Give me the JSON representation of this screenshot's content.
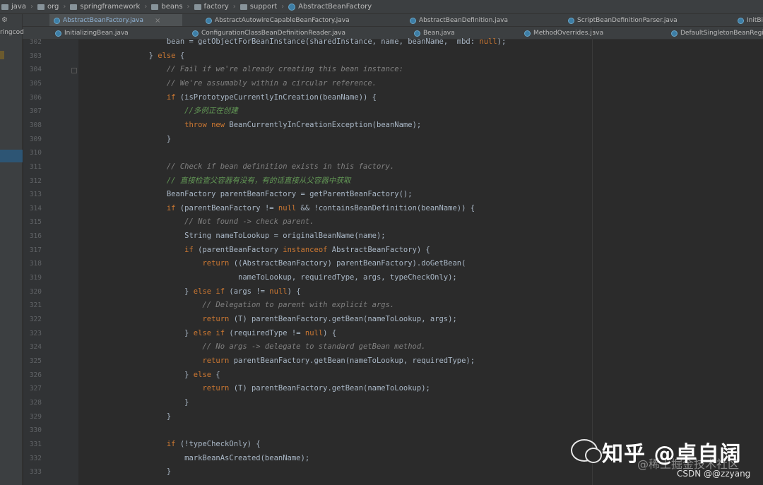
{
  "breadcrumb": [
    "java",
    "org",
    "springframework",
    "beans",
    "factory",
    "support",
    "AbstractBeanFactory"
  ],
  "tabs_row1": [
    {
      "label": "AbstractBeanFactory.java",
      "active": true
    },
    {
      "label": "AbstractAutowireCapableBeanFactory.java"
    },
    {
      "label": "AbstractBeanDefinition.java"
    },
    {
      "label": "ScriptBeanDefinitionParser.java"
    },
    {
      "label": "InitBin"
    }
  ],
  "tabs_row2": [
    {
      "label": "InitializingBean.java"
    },
    {
      "label": "ConfigurationClassBeanDefinitionReader.java"
    },
    {
      "label": "Bean.java"
    },
    {
      "label": "MethodOverrides.java"
    },
    {
      "label": "DefaultSingletonBeanRegis"
    }
  ],
  "sidebar": {
    "label": "ringcod"
  },
  "code_lines": [
    {
      "num": "302",
      "text": "            bean = getObjectForBeanInstance(sharedInstance, name, beanName,  mbd: null);",
      "type": "code"
    },
    {
      "num": "303",
      "text": "        } else {",
      "type": "code"
    },
    {
      "num": "304",
      "text": "            // Fail if we're already creating this bean instance:",
      "type": "comment"
    },
    {
      "num": "305",
      "text": "            // We're assumably within a circular reference.",
      "type": "comment"
    },
    {
      "num": "306",
      "text": "            if (isPrototypeCurrentlyInCreation(beanName)) {",
      "type": "code"
    },
    {
      "num": "307",
      "text": "                //多例正在创建",
      "type": "comment-cn"
    },
    {
      "num": "308",
      "text": "                throw new BeanCurrentlyInCreationException(beanName);",
      "type": "code"
    },
    {
      "num": "309",
      "text": "            }",
      "type": "code"
    },
    {
      "num": "310",
      "text": "",
      "type": "code"
    },
    {
      "num": "311",
      "text": "            // Check if bean definition exists in this factory.",
      "type": "comment"
    },
    {
      "num": "312",
      "text": "            // 直接检查父容器有没有，有的话直接从父容器中获取",
      "type": "comment-cn"
    },
    {
      "num": "313",
      "text": "            BeanFactory parentBeanFactory = getParentBeanFactory();",
      "type": "code"
    },
    {
      "num": "314",
      "text": "            if (parentBeanFactory != null && !containsBeanDefinition(beanName)) {",
      "type": "code"
    },
    {
      "num": "315",
      "text": "                // Not found -> check parent.",
      "type": "comment"
    },
    {
      "num": "316",
      "text": "                String nameToLookup = originalBeanName(name);",
      "type": "code"
    },
    {
      "num": "317",
      "text": "                if (parentBeanFactory instanceof AbstractBeanFactory) {",
      "type": "code"
    },
    {
      "num": "318",
      "text": "                    return ((AbstractBeanFactory) parentBeanFactory).doGetBean(",
      "type": "code"
    },
    {
      "num": "319",
      "text": "                            nameToLookup, requiredType, args, typeCheckOnly);",
      "type": "code"
    },
    {
      "num": "320",
      "text": "                } else if (args != null) {",
      "type": "code"
    },
    {
      "num": "321",
      "text": "                    // Delegation to parent with explicit args.",
      "type": "comment"
    },
    {
      "num": "322",
      "text": "                    return (T) parentBeanFactory.getBean(nameToLookup, args);",
      "type": "code"
    },
    {
      "num": "323",
      "text": "                } else if (requiredType != null) {",
      "type": "code"
    },
    {
      "num": "324",
      "text": "                    // No args -> delegate to standard getBean method.",
      "type": "comment"
    },
    {
      "num": "325",
      "text": "                    return parentBeanFactory.getBean(nameToLookup, requiredType);",
      "type": "code"
    },
    {
      "num": "326",
      "text": "                } else {",
      "type": "code"
    },
    {
      "num": "327",
      "text": "                    return (T) parentBeanFactory.getBean(nameToLookup);",
      "type": "code"
    },
    {
      "num": "328",
      "text": "                }",
      "type": "code"
    },
    {
      "num": "329",
      "text": "            }",
      "type": "code"
    },
    {
      "num": "330",
      "text": "",
      "type": "code"
    },
    {
      "num": "331",
      "text": "            if (!typeCheckOnly) {",
      "type": "code"
    },
    {
      "num": "332",
      "text": "                markBeanAsCreated(beanName);",
      "type": "code"
    },
    {
      "num": "333",
      "text": "            }",
      "type": "code"
    }
  ],
  "keywords": [
    "else",
    "if",
    "throw",
    "new",
    "null",
    "instanceof",
    "return"
  ],
  "watermark": {
    "main": "知乎 @卓自阔",
    "sub": "@稀土掘金技术社区",
    "csdn": "CSDN @@zzyang"
  }
}
